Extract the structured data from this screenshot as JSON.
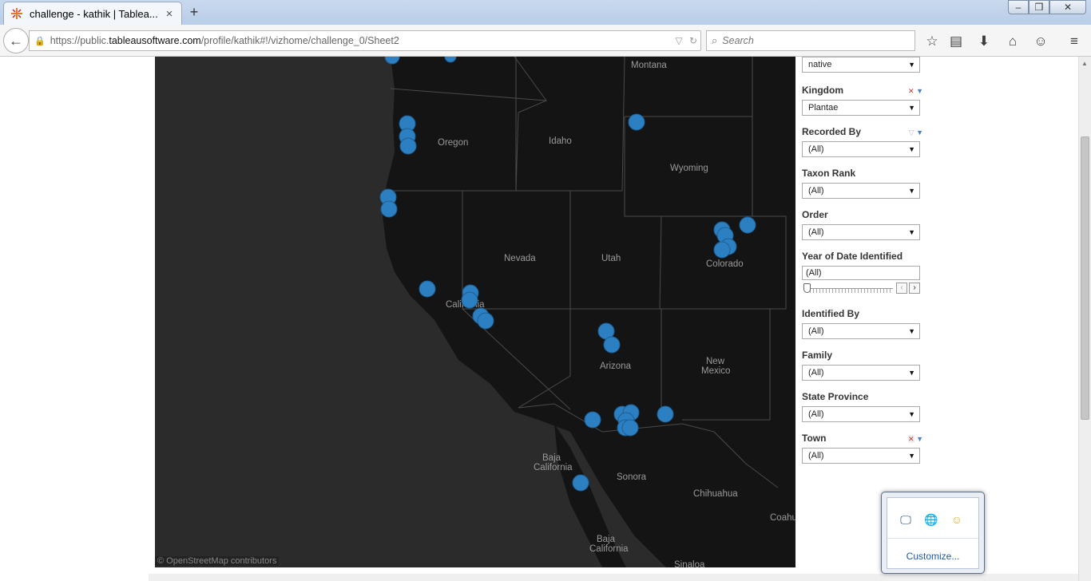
{
  "browser": {
    "tab_title": "challenge - kathik | Tablea...",
    "tab_close": "×",
    "new_tab": "+",
    "url_prefix": "https://public.",
    "url_domain": "tableausoftware.com",
    "url_path": "/profile/kathik#!/vizhome/challenge_0/Sheet2",
    "search_placeholder": "Search"
  },
  "map": {
    "credit": "© OpenStreetMap contributors",
    "labels": [
      "Montana",
      "Oregon",
      "Idaho",
      "Wyoming",
      "Nevada",
      "Utah",
      "Colorado",
      "California",
      "Arizona",
      "New",
      "Mexico",
      "Baja",
      "California",
      "Sonora",
      "Chihuahua",
      "Coahu",
      "Baja",
      "California",
      "Sinaloa"
    ]
  },
  "filters": {
    "native_value": "native",
    "kingdom": {
      "label": "Kingdom",
      "value": "Plantae"
    },
    "recorded_by": {
      "label": "Recorded By",
      "value": "(All)"
    },
    "taxon_rank": {
      "label": "Taxon Rank",
      "value": "(All)"
    },
    "order": {
      "label": "Order",
      "value": "(All)"
    },
    "year_identified": {
      "label": "Year of Date Identified",
      "value": "(All)"
    },
    "identified_by": {
      "label": "Identified By",
      "value": "(All)"
    },
    "family": {
      "label": "Family",
      "value": "(All)"
    },
    "state_province": {
      "label": "State Province",
      "value": "(All)"
    },
    "town": {
      "label": "Town",
      "value": "(All)"
    }
  },
  "tray": {
    "customize": "Customize..."
  },
  "colors": {
    "point": "#2c7fc0",
    "map_background": "#1b1b1b"
  }
}
